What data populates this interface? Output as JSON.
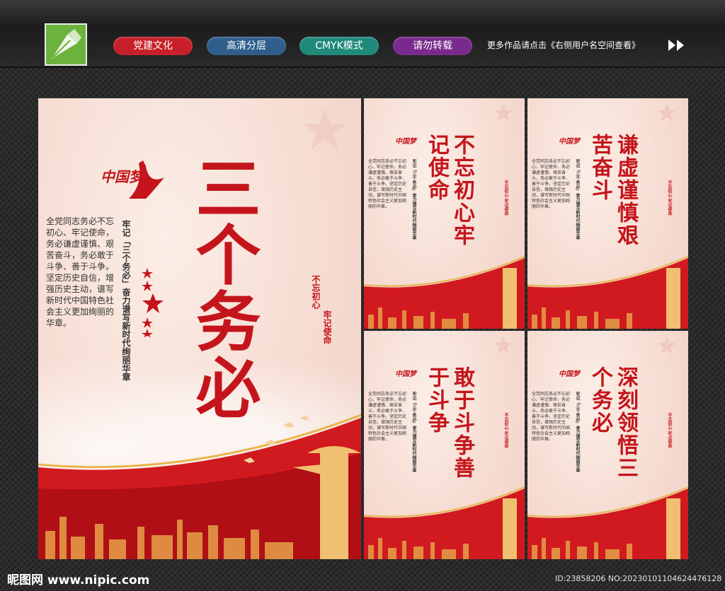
{
  "header": {
    "tags": [
      {
        "label": "党建文化",
        "color": "#c8202a"
      },
      {
        "label": "高清分层",
        "color": "#2f5e8c"
      },
      {
        "label": "CMYK模式",
        "color": "#1f8a7a"
      },
      {
        "label": "请勿转载",
        "color": "#7a2a8c"
      }
    ],
    "notice": "更多作品请点击《右侧用户名空间查看》",
    "logo_icon": "pen-nib-icon",
    "arrow_icon": "double-chevron-right-icon"
  },
  "main_poster": {
    "dream_logo": "中国梦",
    "title": "三个务必",
    "vertical_heading": "牢记「三个务必」奋力谱写新时代绚丽华章",
    "body": "全党同志务必不忘初心、牢记使命，务必谦虚谨慎、艰苦奋斗，务必敢于斗争、善于斗争。坚定历史自信，增强历史主动，谱写新时代中国特色社会主义更加绚丽的华章。",
    "slogan_1": "不忘初心",
    "slogan_2": "牢记使命"
  },
  "small_posters": [
    {
      "title": "不忘初心牢记使命"
    },
    {
      "title": "谦虚谨慎艰苦奋斗"
    },
    {
      "title": "敢于斗争善于斗争"
    },
    {
      "title": "深刻领悟三个务必"
    }
  ],
  "small_poster_common": {
    "dream_logo": "中国梦",
    "vertical_heading": "牢记「三个务必」奋力谱写新时代绚丽华章",
    "body": "全党同志务必不忘初心、牢记使命，务必谦虚谨慎、艰苦奋斗，务必敢于斗争、善于斗争。坚定历史自信，增强历史主动，谱写新时代中国特色社会主义更加绚丽的华章。",
    "slogan": "不忘初心 牢记使命"
  },
  "footer": {
    "site": "昵图网 www.nipic.com",
    "id_text": "ID:23858206 NO:20230101104624476128"
  },
  "colors": {
    "accent": "#c4151c",
    "gold": "#e0a43a"
  }
}
